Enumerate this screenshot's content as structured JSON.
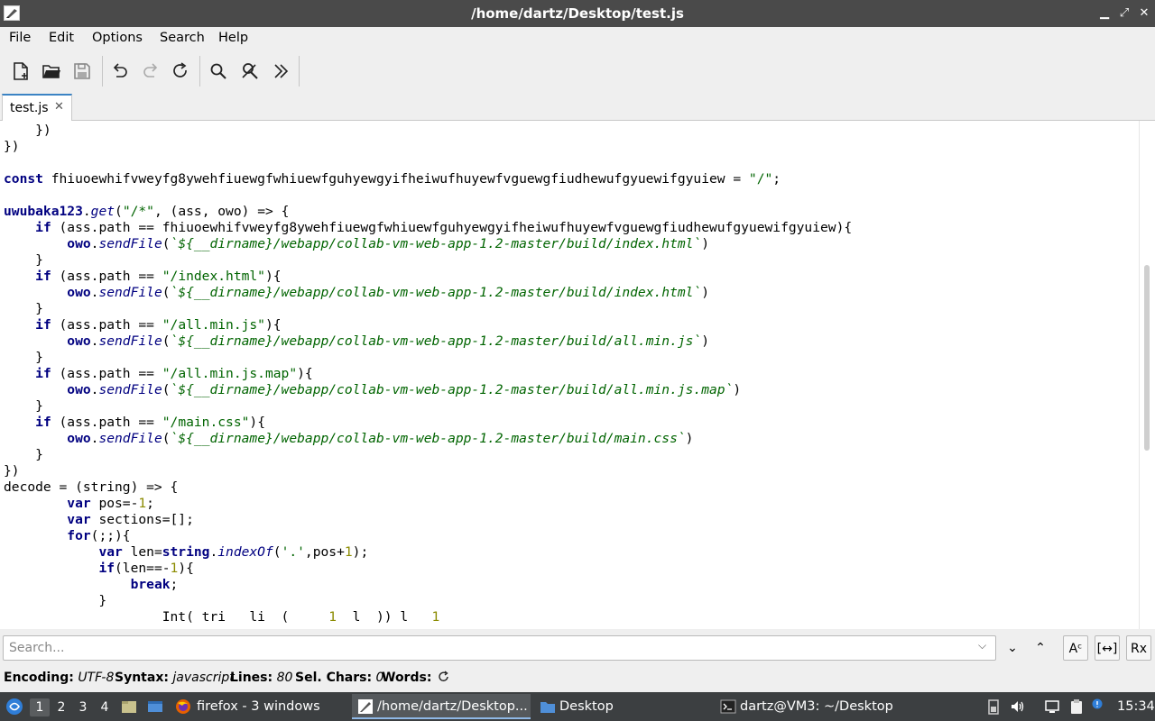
{
  "window": {
    "title": "/home/dartz/Desktop/test.js",
    "minimize": "▁",
    "maximize": "⤢",
    "close": "✕"
  },
  "menu": [
    "File",
    "Edit",
    "Options",
    "Search",
    "Help"
  ],
  "toolbar_icons": [
    "new-file-icon",
    "open-folder-icon",
    "save-icon",
    "undo-icon",
    "redo-icon",
    "reload-icon",
    "find-icon",
    "find-replace-icon",
    "more-icon"
  ],
  "tab": {
    "label": "test.js",
    "close": "✕"
  },
  "code_lines": [
    "    })",
    "})",
    "",
    "const fhiuoewhifvweyfg8ywehfiuewgfwhiuewfguhyewgyifheiwufhuyewfvguewgfiudhewufgyuewifgyuiew = \"/\";",
    "",
    "uwubaka123.get(\"/*\", (ass, owo) => {",
    "    if (ass.path == fhiuoewhifvweyfg8ywehfiuewgfwhiuewfguhyewgyifheiwufhuyewfvguewgfiudhewufgyuewifgyuiew){",
    "        owo.sendFile(`${__dirname}/webapp/collab-vm-web-app-1.2-master/build/index.html`)",
    "    }",
    "    if (ass.path == \"/index.html\"){",
    "        owo.sendFile(`${__dirname}/webapp/collab-vm-web-app-1.2-master/build/index.html`)",
    "    }",
    "    if (ass.path == \"/all.min.js\"){",
    "        owo.sendFile(`${__dirname}/webapp/collab-vm-web-app-1.2-master/build/all.min.js`)",
    "    }",
    "    if (ass.path == \"/all.min.js.map\"){",
    "        owo.sendFile(`${__dirname}/webapp/collab-vm-web-app-1.2-master/build/all.min.js.map`)",
    "    }",
    "    if (ass.path == \"/main.css\"){",
    "        owo.sendFile(`${__dirname}/webapp/collab-vm-web-app-1.2-master/build/main.css`)",
    "    }",
    "})",
    "decode = (string) => {",
    "        var pos=-1;",
    "        var sections=[];",
    "        for(;;){",
    "            var len=string.indexOf('.',pos+1);",
    "            if(len==-1){",
    "                break;",
    "            }",
    "                    Int( tri   li  (     1  l  )) l   1"
  ],
  "search": {
    "placeholder": "Search...",
    "dropdown": "⌵",
    "next": "⌄",
    "prev": "⌃",
    "match_case": "Aᶜ",
    "whole_word": "[↔]",
    "regex": "Rx"
  },
  "status": {
    "encoding_label": "Encoding:",
    "encoding_value": "UTF-8",
    "syntax_label": "Syntax:",
    "syntax_value": "javascript",
    "lines_label": "Lines:",
    "lines_value": "80",
    "selchars_label": "Sel. Chars:",
    "selchars_value": "0",
    "words_label": "Words:"
  },
  "taskbar": {
    "workspaces": [
      "1",
      "2",
      "3",
      "4"
    ],
    "tasks": [
      {
        "label": "firefox - 3 windows",
        "icon": "firefox-icon"
      },
      {
        "label": "/home/dartz/Desktop...",
        "icon": "text-editor-icon"
      },
      {
        "label": "Desktop",
        "icon": "folder-icon"
      },
      {
        "label": "dartz@VM3: ~/Desktop",
        "icon": "terminal-icon"
      }
    ],
    "clock": "15:34"
  },
  "colors": {
    "keyword": "#000080",
    "string": "#006400",
    "number": "#8b8b00",
    "accent": "#3b83c4",
    "taskbar": "#3c3f41"
  }
}
